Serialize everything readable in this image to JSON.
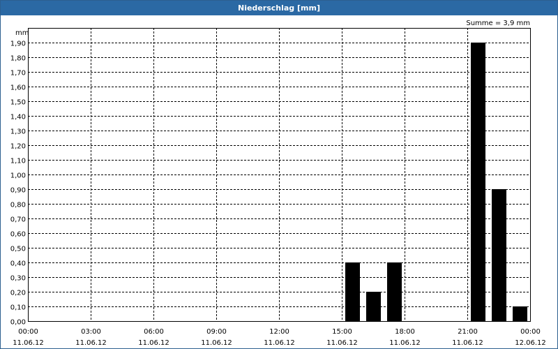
{
  "window": {
    "title": "Niederschlag [mm]"
  },
  "chart_data": {
    "type": "bar",
    "title": "Niederschlag [mm]",
    "ylabel": "mm",
    "annotation": "Summe = 3,9 mm",
    "ylim": [
      0,
      2.0
    ],
    "y_ticks": [
      "0,00",
      "0,10",
      "0,20",
      "0,30",
      "0,40",
      "0,50",
      "0,60",
      "0,70",
      "0,80",
      "0,90",
      "1,00",
      "1,10",
      "1,20",
      "1,30",
      "1,40",
      "1,50",
      "1,60",
      "1,70",
      "1,80",
      "1,90"
    ],
    "x_ticks": [
      {
        "time": "00:00",
        "date": "11.06.12"
      },
      {
        "time": "03:00",
        "date": "11.06.12"
      },
      {
        "time": "06:00",
        "date": "11.06.12"
      },
      {
        "time": "09:00",
        "date": "11.06.12"
      },
      {
        "time": "12:00",
        "date": "11.06.12"
      },
      {
        "time": "15:00",
        "date": "11.06.12"
      },
      {
        "time": "18:00",
        "date": "11.06.12"
      },
      {
        "time": "21:00",
        "date": "11.06.12"
      },
      {
        "time": "00:00",
        "date": "12.06.12"
      }
    ],
    "xlim": [
      "11.06.12 00:00",
      "12.06.12 00:00"
    ],
    "bar_color": "#000000",
    "bars": [
      {
        "start": "11.06.12 15:00",
        "end": "11.06.12 16:00",
        "value": 0.4
      },
      {
        "start": "11.06.12 16:00",
        "end": "11.06.12 17:00",
        "value": 0.2
      },
      {
        "start": "11.06.12 17:00",
        "end": "11.06.12 18:00",
        "value": 0.4
      },
      {
        "start": "11.06.12 21:00",
        "end": "11.06.12 22:00",
        "value": 1.9
      },
      {
        "start": "11.06.12 22:00",
        "end": "11.06.12 23:00",
        "value": 0.9
      },
      {
        "start": "11.06.12 23:00",
        "end": "12.06.12 00:00",
        "value": 0.1
      }
    ]
  }
}
